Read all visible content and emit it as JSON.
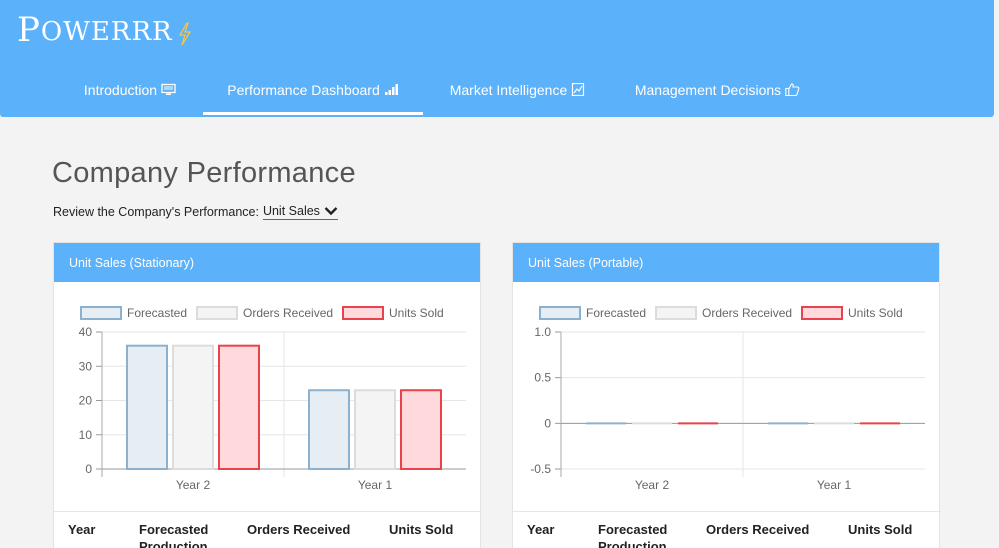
{
  "brand": {
    "first": "P",
    "rest": "OWERRR"
  },
  "nav": {
    "items": [
      {
        "label": "Introduction",
        "icon": "monitor-icon"
      },
      {
        "label": "Performance Dashboard",
        "icon": "signal-bars-icon",
        "active": true
      },
      {
        "label": "Market Intelligence",
        "icon": "line-chart-icon"
      },
      {
        "label": "Management Decisions",
        "icon": "thumbs-up-icon"
      }
    ]
  },
  "page": {
    "title": "Company Performance",
    "review_label": "Review the Company's Performance:",
    "selected_metric": "Unit Sales"
  },
  "colors": {
    "primary": "#5bb1fa",
    "forecasted_fill": "#e7eef3",
    "forecasted_stroke": "#8ab1cf",
    "orders_fill": "#f4f4f4",
    "orders_stroke": "#dcdcdc",
    "units_fill": "#ffd9dc",
    "units_stroke": "#e8434b"
  },
  "cards": [
    {
      "title": "Unit Sales (Stationary)",
      "table_headers": [
        "Year",
        "Forecasted Production",
        "Orders Received",
        "Units Sold"
      ]
    },
    {
      "title": "Unit Sales (Portable)",
      "table_headers": [
        "Year",
        "Forecasted Production",
        "Orders Received",
        "Units Sold"
      ]
    }
  ],
  "chart_data": [
    {
      "type": "bar",
      "categories": [
        "Year 2",
        "Year 1"
      ],
      "series": [
        {
          "name": "Forecasted",
          "values": [
            36,
            23
          ]
        },
        {
          "name": "Orders Received",
          "values": [
            36,
            23
          ]
        },
        {
          "name": "Units Sold",
          "values": [
            36,
            23
          ]
        }
      ],
      "ylim": [
        0,
        40
      ],
      "yticks": [
        "40",
        "30",
        "20",
        "10",
        "0"
      ],
      "ytick_values": [
        40,
        30,
        20,
        10,
        0
      ],
      "legend": "top",
      "grid": true
    },
    {
      "type": "bar",
      "categories": [
        "Year 2",
        "Year 1"
      ],
      "series": [
        {
          "name": "Forecasted",
          "values": [
            0,
            0
          ]
        },
        {
          "name": "Orders Received",
          "values": [
            0,
            0
          ]
        },
        {
          "name": "Units Sold",
          "values": [
            0,
            0
          ]
        }
      ],
      "ylim": [
        -0.5,
        1.0
      ],
      "yticks": [
        "1.0",
        "0.5",
        "0",
        "-0.5"
      ],
      "ytick_values": [
        1.0,
        0.5,
        0,
        -0.5
      ],
      "legend": "top",
      "grid": true
    }
  ]
}
